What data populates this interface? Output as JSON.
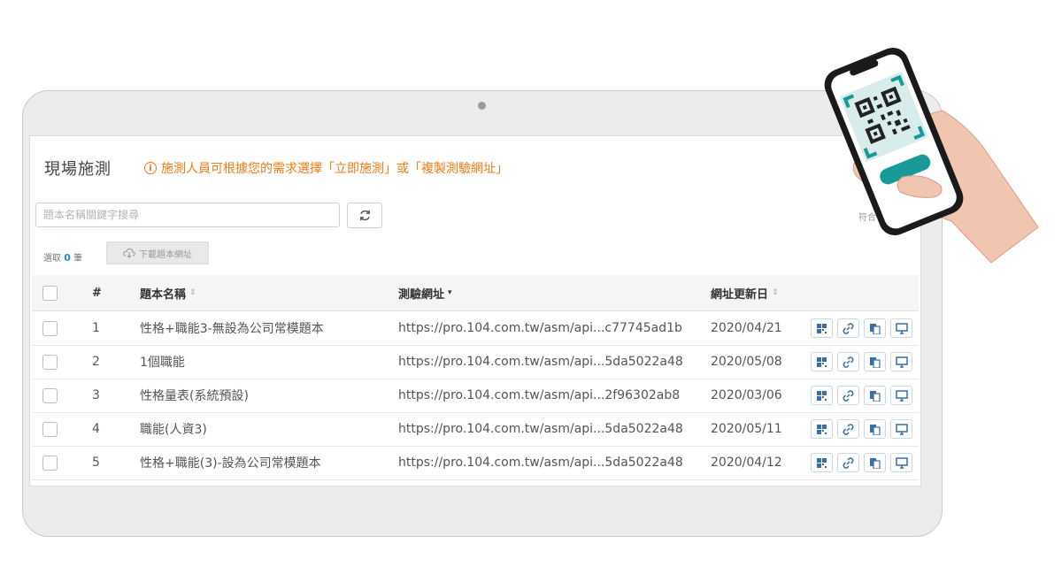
{
  "page": {
    "title": "現場施測",
    "notice": "施測人員可根據您的需求選擇「立即施測」或「複製測驗網址」",
    "search_placeholder": "題本名稱關鍵字搜尋",
    "match_text": "符合",
    "selected_prefix": "選取",
    "selected_count": "0",
    "selected_suffix": "筆",
    "download_label": "下載題本網址"
  },
  "table": {
    "headers": {
      "index": "#",
      "name": "題本名稱",
      "url": "測驗網址",
      "date": "網址更新日"
    },
    "rows": [
      {
        "index": "1",
        "name": "性格+職能3-無設為公司常模題本",
        "url": "https://pro.104.com.tw/asm/api...c77745ad1b",
        "date": "2020/04/21"
      },
      {
        "index": "2",
        "name": "1個職能",
        "url": "https://pro.104.com.tw/asm/api...5da5022a48",
        "date": "2020/05/08"
      },
      {
        "index": "3",
        "name": "性格量表(系統預設)",
        "url": "https://pro.104.com.tw/asm/api...2f96302ab8",
        "date": "2020/03/06"
      },
      {
        "index": "4",
        "name": "職能(人資3)",
        "url": "https://pro.104.com.tw/asm/api...5da5022a48",
        "date": "2020/05/11"
      },
      {
        "index": "5",
        "name": "性格+職能(3)-設為公司常模題本",
        "url": "https://pro.104.com.tw/asm/api...5da5022a48",
        "date": "2020/04/12"
      }
    ]
  },
  "colors": {
    "accent_orange": "#f07a14",
    "link_blue": "#1f8fd6",
    "icon_blue": "#3a6ea8",
    "qr_teal": "#1a9a97"
  },
  "icons": [
    "info-icon",
    "refresh-icon",
    "cloud-download-icon",
    "qr-code-icon",
    "link-icon",
    "copy-icon",
    "monitor-icon",
    "sort-icon"
  ]
}
